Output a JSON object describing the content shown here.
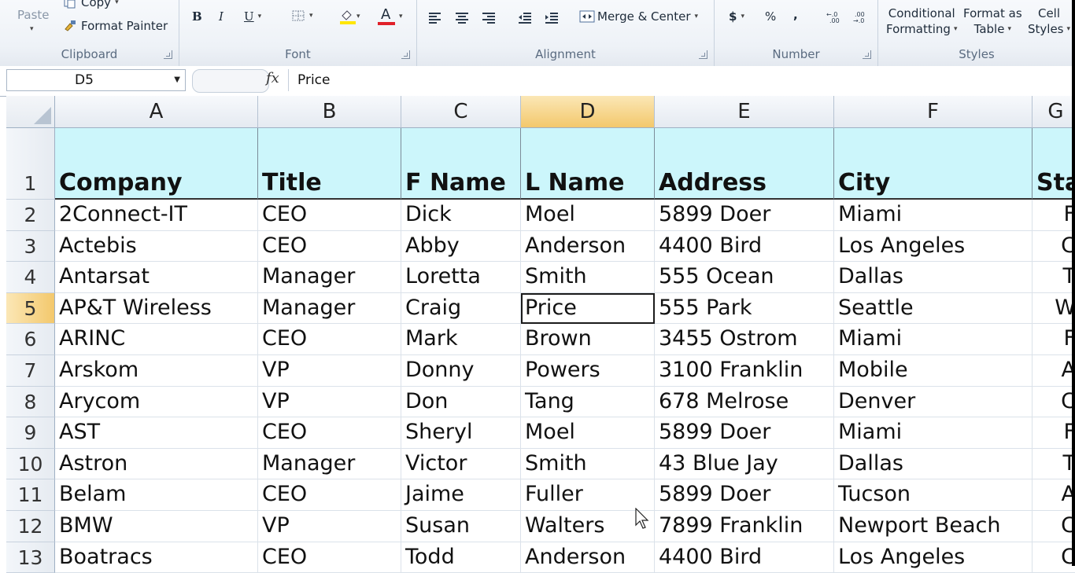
{
  "ribbon": {
    "clipboard": {
      "label": "Clipboard",
      "paste": "Paste",
      "copy": "Copy",
      "format_painter": "Format Painter"
    },
    "font": {
      "label": "Font",
      "bold": "B",
      "italic": "I",
      "underline": "U",
      "font_color_letter": "A"
    },
    "alignment": {
      "label": "Alignment",
      "merge_center": "Merge & Center"
    },
    "number": {
      "label": "Number",
      "currency": "$",
      "percent": "%",
      "comma": ","
    },
    "styles": {
      "label": "Styles",
      "conditional_formatting_1": "Conditional",
      "conditional_formatting_2": "Formatting",
      "format_as_table_1": "Format as",
      "format_as_table_2": "Table",
      "cell_styles_1": "Cell",
      "cell_styles_2": "Styles"
    }
  },
  "formula_bar": {
    "name_box": "D5",
    "fx": "fx",
    "value": "Price"
  },
  "columns": [
    "A",
    "B",
    "C",
    "D",
    "E",
    "F",
    "G"
  ],
  "selected_column": "D",
  "selected_row": "5",
  "header_row": {
    "row_number": "1",
    "cells": [
      "Company",
      "Title",
      "F Name",
      "L Name",
      "Address",
      "City",
      "Sta"
    ]
  },
  "rows": [
    {
      "n": "2",
      "cells": [
        "2Connect-IT",
        "CEO",
        "Dick",
        "Moel",
        "5899 Doer",
        "Miami",
        "F"
      ]
    },
    {
      "n": "3",
      "cells": [
        "Actebis",
        "CEO",
        "Abby",
        "Anderson",
        "4400 Bird",
        "Los Angeles",
        "C"
      ]
    },
    {
      "n": "4",
      "cells": [
        "Antarsat",
        "Manager",
        "Loretta",
        "Smith",
        "555 Ocean",
        "Dallas",
        "T"
      ]
    },
    {
      "n": "5",
      "cells": [
        "AP&T Wireless",
        "Manager",
        "Craig",
        "Price",
        "555 Park",
        "Seattle",
        "W"
      ]
    },
    {
      "n": "6",
      "cells": [
        "ARINC",
        "CEO",
        "Mark",
        "Brown",
        "3455 Ostrom",
        "Miami",
        "F"
      ]
    },
    {
      "n": "7",
      "cells": [
        "Arskom",
        "VP",
        "Donny",
        "Powers",
        "3100 Franklin",
        "Mobile",
        "A"
      ]
    },
    {
      "n": "8",
      "cells": [
        "Arycom",
        "VP",
        "Don",
        "Tang",
        "678 Melrose",
        "Denver",
        "C"
      ]
    },
    {
      "n": "9",
      "cells": [
        "AST",
        "CEO",
        "Sheryl",
        "Moel",
        "5899 Doer",
        "Miami",
        "F"
      ]
    },
    {
      "n": "10",
      "cells": [
        "Astron",
        "Manager",
        "Victor",
        "Smith",
        "43 Blue Jay",
        "Dallas",
        "T"
      ]
    },
    {
      "n": "11",
      "cells": [
        "Belam",
        "CEO",
        "Jaime",
        "Fuller",
        "5899 Doer",
        "Tucson",
        "A"
      ]
    },
    {
      "n": "12",
      "cells": [
        "BMW",
        "VP",
        "Susan",
        "Walters",
        "7899 Franklin",
        "Newport Beach",
        "C"
      ]
    },
    {
      "n": "13",
      "cells": [
        "Boatracs",
        "CEO",
        "Todd",
        "Anderson",
        "4400 Bird",
        "Los Angeles",
        "C"
      ]
    }
  ],
  "colors": {
    "header_fill": "#ccf6fb",
    "selection_header": "#f3c86c",
    "font_color_bar": "#e0202a",
    "highlight_bar": "#ffe600"
  }
}
